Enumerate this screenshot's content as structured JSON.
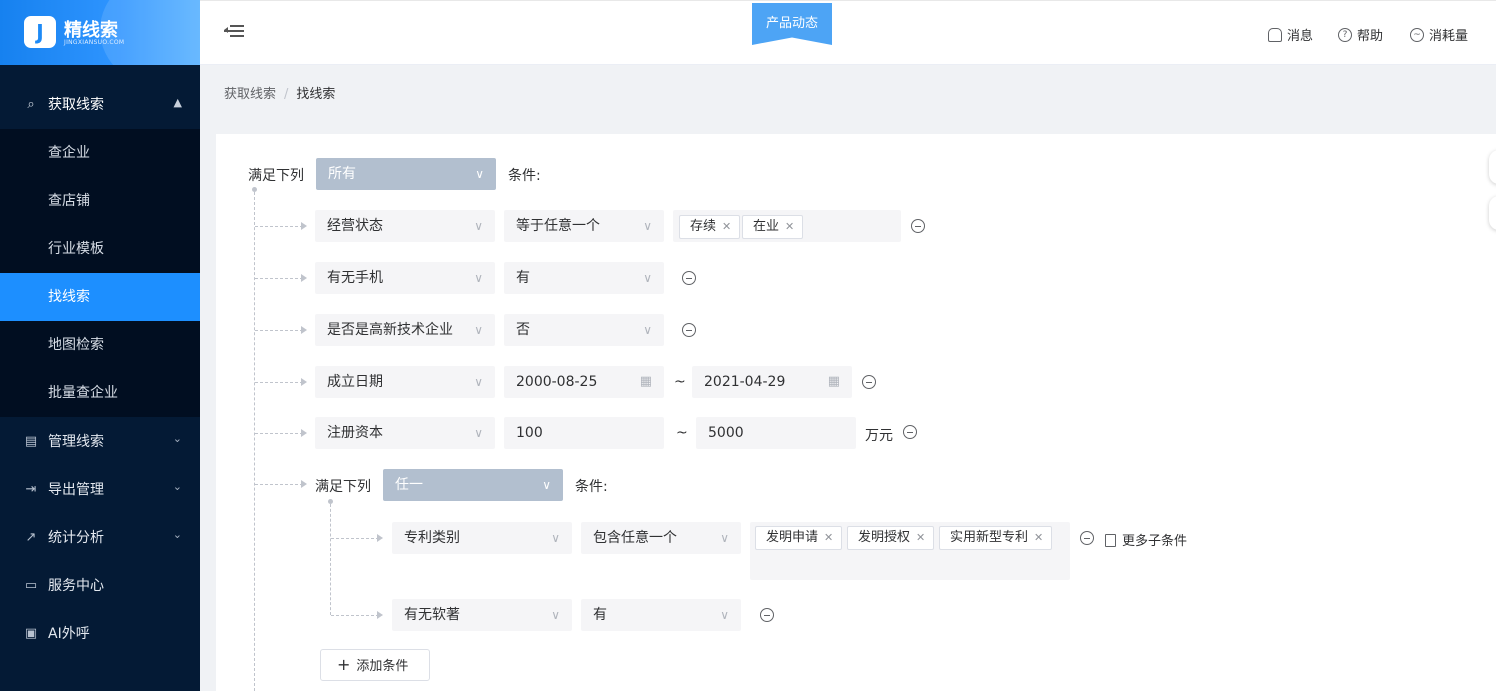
{
  "brand": {
    "name": "精线索",
    "sub": "JINGXIANSUO.COM",
    "mark": "J"
  },
  "sidebar": {
    "group": {
      "label": "获取线索",
      "expanded": true
    },
    "sub_items": [
      {
        "label": "查企业",
        "active": false
      },
      {
        "label": "查店铺",
        "active": false
      },
      {
        "label": "行业模板",
        "active": false
      },
      {
        "label": "找线索",
        "active": true
      },
      {
        "label": "地图检索",
        "active": false
      },
      {
        "label": "批量查企业",
        "active": false
      }
    ],
    "items": [
      {
        "label": "管理线索",
        "icon": "clipboard-icon",
        "has_chevron": true
      },
      {
        "label": "导出管理",
        "icon": "export-icon",
        "has_chevron": true
      },
      {
        "label": "统计分析",
        "icon": "chart-icon",
        "has_chevron": true
      },
      {
        "label": "服务中心",
        "icon": "card-icon",
        "has_chevron": false
      },
      {
        "label": "AI外呼",
        "icon": "ai-call-icon",
        "has_chevron": false
      }
    ]
  },
  "header": {
    "product_news": "产品动态",
    "links": [
      {
        "label": "消息",
        "icon": "bell-icon"
      },
      {
        "label": "帮助",
        "icon": "help-icon"
      },
      {
        "label": "消耗量",
        "icon": "usage-icon"
      }
    ]
  },
  "breadcrumb": [
    "获取线索",
    "找线索"
  ],
  "filter": {
    "root_prefix": "满足下列",
    "root_match": "所有",
    "root_suffix": "条件:",
    "rows": [
      {
        "field": "经营状态",
        "op": "等于任意一个",
        "tags": [
          "存续",
          "在业"
        ]
      },
      {
        "field": "有无手机",
        "op": "有"
      },
      {
        "field": "是否是高新技术企业",
        "op": "否"
      },
      {
        "field": "成立日期",
        "from": "2000-08-25",
        "to": "2021-04-29",
        "range_sep": "~"
      },
      {
        "field": "注册资本",
        "from": "100",
        "to": "5000",
        "unit": "万元",
        "range_sep": "~"
      }
    ],
    "sub_group": {
      "prefix": "满足下列",
      "match": "任一",
      "suffix": "条件:",
      "rows": [
        {
          "field": "专利类别",
          "op": "包含任意一个",
          "tags": [
            "发明申请",
            "发明授权",
            "实用新型专利"
          ]
        },
        {
          "field": "有无软著",
          "op": "有"
        }
      ],
      "more_label": "更多子条件"
    },
    "add_label": "添加条件"
  },
  "colors": {
    "sidebar_bg": "#041a35",
    "active_item": "#1d8fff",
    "accent": "#4da4f5"
  }
}
